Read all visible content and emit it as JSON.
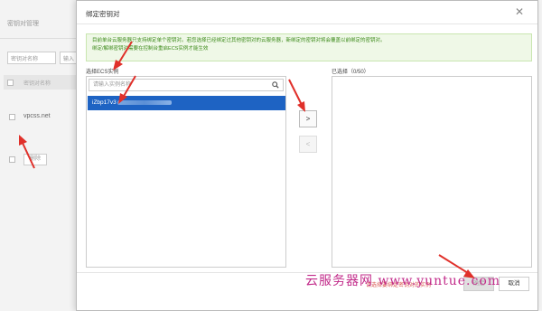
{
  "background": {
    "title": "密钥对管理",
    "filter_select": "密钥对名称",
    "filter_input": "输入",
    "table_header": "密钥对名称",
    "row_name": "vpcss.net",
    "delete_button": "删除"
  },
  "modal": {
    "title": "绑定密钥对",
    "notice_lines": [
      "目前单台云服务器只支持绑定单个密钥对。若您选择已经绑定过其他密钥对的云服务器，新绑定的密钥对将会覆盖以前绑定的密钥对。",
      "绑定/解绑密钥对需要在控制台重启ECS实例才能生效"
    ],
    "left_label": "选择ECS实例",
    "right_label": "已选择（0/50）",
    "search_placeholder": "请输入实例名称",
    "instance_item": "iZbp17v3",
    "move_right": ">",
    "move_left": "<",
    "footer_hint": "请选择要绑定密钥对的实例",
    "confirm_label": "确定",
    "cancel_label": "取消"
  },
  "watermark": "云服务器网 www.yuntue.com",
  "colors": {
    "selected_item": "#1e63c3",
    "notice_bg": "#eff8e7",
    "notice_text": "#3c8a1a",
    "annotation_arrow": "#e0302a",
    "watermark": "#c22b8a"
  }
}
